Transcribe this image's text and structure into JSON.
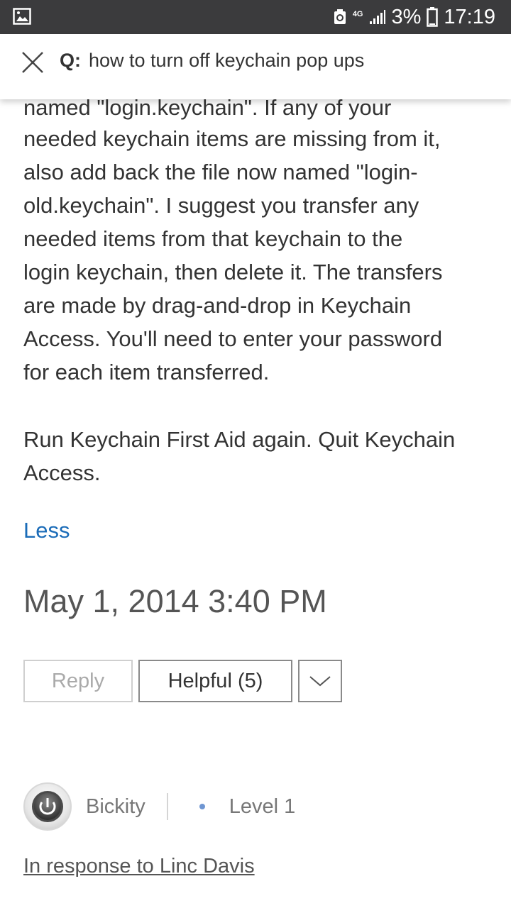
{
  "status_bar": {
    "network_label": "4G",
    "battery_percent": "3%",
    "time": "17:19",
    "icons": [
      "gallery-icon",
      "sync-icon",
      "network-icon",
      "signal-icon",
      "battery-icon"
    ]
  },
  "search": {
    "prefix": "Q:",
    "query": "how to turn off keychain pop ups"
  },
  "post": {
    "partial_top_line": "named \"login.keychain\". If any of your",
    "paragraph1_lines": [
      "needed keychain items are missing from it,",
      "also add back the file now named \"login-",
      "old.keychain\". I suggest you transfer any",
      "needed items from that keychain to the",
      "login keychain, then delete it. The transfers",
      "are made by drag-and-drop in Keychain",
      "Access. You'll need to enter your password",
      "for each item transferred."
    ],
    "paragraph2_lines": [
      "Run Keychain First Aid again. Quit Keychain",
      "Access."
    ],
    "less_label": "Less",
    "date": "May 1, 2014 3:40 PM",
    "reply_label": "Reply",
    "helpful_label": "Helpful (5)"
  },
  "reply_author": {
    "name": "Bickity",
    "level": "Level 1",
    "response_link": "In response to Linc Davis"
  },
  "colors": {
    "status_bar_bg": "#3b3b3d",
    "link_blue": "#1b6cb8",
    "text": "#333333",
    "level_dot": "#6f96d2"
  }
}
